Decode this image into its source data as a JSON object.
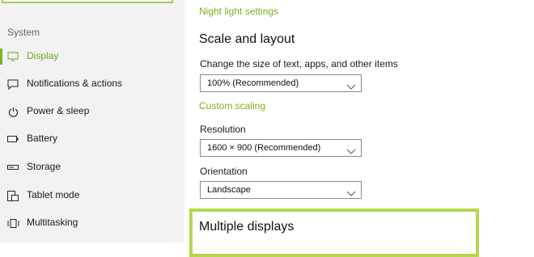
{
  "sidebar": {
    "section_label": "System",
    "items": [
      {
        "label": "Display",
        "icon": "monitor-icon"
      },
      {
        "label": "Notifications & actions",
        "icon": "notifications-icon"
      },
      {
        "label": "Power & sleep",
        "icon": "power-icon"
      },
      {
        "label": "Battery",
        "icon": "battery-icon"
      },
      {
        "label": "Storage",
        "icon": "storage-icon"
      },
      {
        "label": "Tablet mode",
        "icon": "tablet-mode-icon"
      },
      {
        "label": "Multitasking",
        "icon": "multitasking-icon"
      }
    ],
    "active_index": 0
  },
  "main": {
    "night_light_link": "Night light settings",
    "scale_heading": "Scale and layout",
    "scale_label": "Change the size of text, apps, and other items",
    "scale_value": "100% (Recommended)",
    "custom_scaling_link": "Custom scaling",
    "resolution_label": "Resolution",
    "resolution_value": "1600 × 900 (Recommended)",
    "orientation_label": "Orientation",
    "orientation_value": "Landscape",
    "multiple_displays_heading": "Multiple displays"
  },
  "colors": {
    "accent_green": "#7ab61f",
    "link_green": "#7cae1f",
    "highlight_green": "#b5d84a"
  }
}
